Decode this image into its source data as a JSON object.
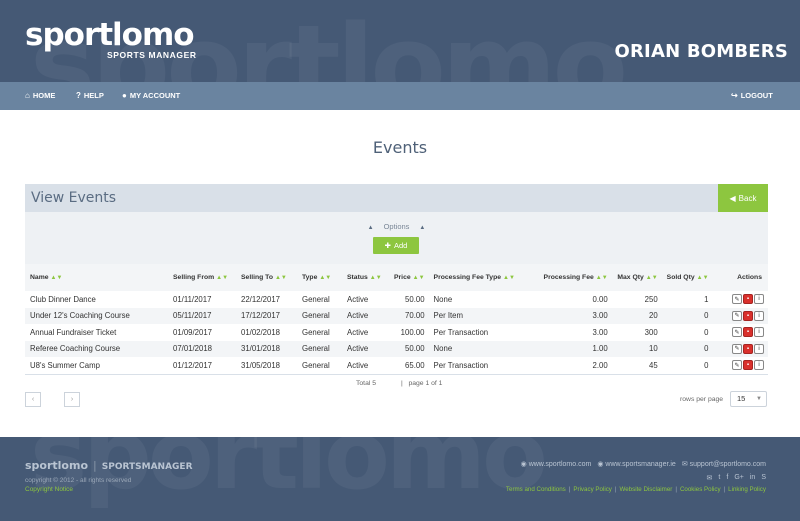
{
  "header": {
    "logo_main": "sportlomo",
    "logo_sub": "SPORTS MANAGER",
    "watermark": "sportlomo",
    "team_name": "ORIAN BOMBERS"
  },
  "nav": {
    "home": "HOME",
    "help": "HELP",
    "account": "MY ACCOUNT",
    "logout": "LOGOUT"
  },
  "page": {
    "title": "Events",
    "panel_title": "View Events",
    "back_label": "Back",
    "options_label": "Options",
    "add_label": "Add"
  },
  "table": {
    "columns": [
      "Name",
      "Selling From",
      "Selling To",
      "Type",
      "Status",
      "Price",
      "Processing Fee Type",
      "Processing Fee",
      "Max Qty",
      "Sold Qty",
      "Actions"
    ],
    "rows": [
      [
        "Club Dinner Dance",
        "01/11/2017",
        "22/12/2017",
        "General",
        "Active",
        "50.00",
        "None",
        "0.00",
        "250",
        "1"
      ],
      [
        "Under 12's Coaching Course",
        "05/11/2017",
        "17/12/2017",
        "General",
        "Active",
        "70.00",
        "Per Item",
        "3.00",
        "20",
        "0"
      ],
      [
        "Annual Fundraiser Ticket",
        "01/09/2017",
        "01/02/2018",
        "General",
        "Active",
        "100.00",
        "Per Transaction",
        "3.00",
        "300",
        "0"
      ],
      [
        "Referee Coaching Course",
        "07/01/2018",
        "31/01/2018",
        "General",
        "Active",
        "50.00",
        "None",
        "1.00",
        "10",
        "0"
      ],
      [
        "U8's Summer Camp",
        "01/12/2017",
        "31/05/2018",
        "General",
        "Active",
        "65.00",
        "Per Transaction",
        "2.00",
        "45",
        "0"
      ]
    ],
    "total": "Total 5",
    "page_info": "page 1 of 1"
  },
  "pagination": {
    "rows_per_page_label": "rows per page",
    "rows_per_page_value": "15"
  },
  "footer": {
    "logo": "sportlomo",
    "logo_sub": "SPORTSMANAGER",
    "watermark": "sportlomo",
    "copyright": "copyright © 2012 - all rights reserved",
    "notice": "Copyright Notice",
    "link1": "www.sportlomo.com",
    "link2": "www.sportsmanager.ie",
    "email": "support@sportlomo.com",
    "legal": [
      "Terms and Conditions",
      "Privacy Policy",
      "Website Disclaimer",
      "Cookies Policy",
      "Linking Policy"
    ]
  },
  "colors": {
    "header": "#455975",
    "nav": "#6a84a0",
    "accent": "#8dc63f",
    "delete": "#d9302c"
  }
}
